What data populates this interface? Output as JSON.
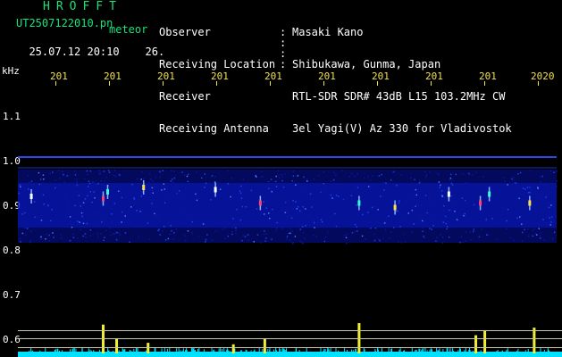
{
  "header": {
    "logo": "HROFFT",
    "filename": "UT2507122010.pn",
    "meteor_label": "meteor",
    "datetime": "25.07.12 20:10",
    "count": "26."
  },
  "info": [
    {
      "label": "Observer",
      "value": "Masaki Kano"
    },
    {
      "label": "Receiving Location",
      "value": "Shibukawa, Gunma, Japan"
    },
    {
      "label": "Receiver",
      "value": "RTL-SDR SDR# 43dB L15 103.2MHz CW"
    },
    {
      "label": "Receiving Antenna",
      "value": "3el Yagi(V) Az 330 for Vladivostok"
    }
  ],
  "y_axis": {
    "unit": "kHz",
    "labels": [
      "1.1",
      "1.0",
      "0.9",
      "0.8",
      "0.7",
      "0.6"
    ]
  },
  "x_axis": {
    "labels": [
      "201",
      "201",
      "201",
      "201",
      "201",
      "201",
      "201",
      "201",
      "201",
      "2020"
    ]
  },
  "colors": {
    "background": "#000000",
    "header_green": "#19e37a",
    "axis_yellow": "#f2e24a",
    "signal_band": "#0a1ac0",
    "baseline_cyan": "#00e0ff"
  },
  "signals": [
    {
      "minute": 0.3,
      "freq": 0.92
    },
    {
      "minute": 1.9,
      "freq": 0.915
    },
    {
      "minute": 2.0,
      "freq": 0.93
    },
    {
      "minute": 2.8,
      "freq": 0.94
    },
    {
      "minute": 4.4,
      "freq": 0.935
    },
    {
      "minute": 5.4,
      "freq": 0.905
    },
    {
      "minute": 7.6,
      "freq": 0.905
    },
    {
      "minute": 8.4,
      "freq": 0.895
    },
    {
      "minute": 9.6,
      "freq": 0.925
    },
    {
      "minute": 10.3,
      "freq": 0.905
    },
    {
      "minute": 10.5,
      "freq": 0.925
    },
    {
      "minute": 11.4,
      "freq": 0.905
    }
  ],
  "meteor_peaks": [
    {
      "minute": 1.9,
      "level": 0.95
    },
    {
      "minute": 2.2,
      "level": 0.5
    },
    {
      "minute": 2.9,
      "level": 0.35
    },
    {
      "minute": 4.8,
      "level": 0.3
    },
    {
      "minute": 5.5,
      "level": 0.5
    },
    {
      "minute": 7.6,
      "level": 1.0
    },
    {
      "minute": 10.2,
      "level": 0.6
    },
    {
      "minute": 10.4,
      "level": 0.75
    },
    {
      "minute": 11.5,
      "level": 0.85
    }
  ]
}
